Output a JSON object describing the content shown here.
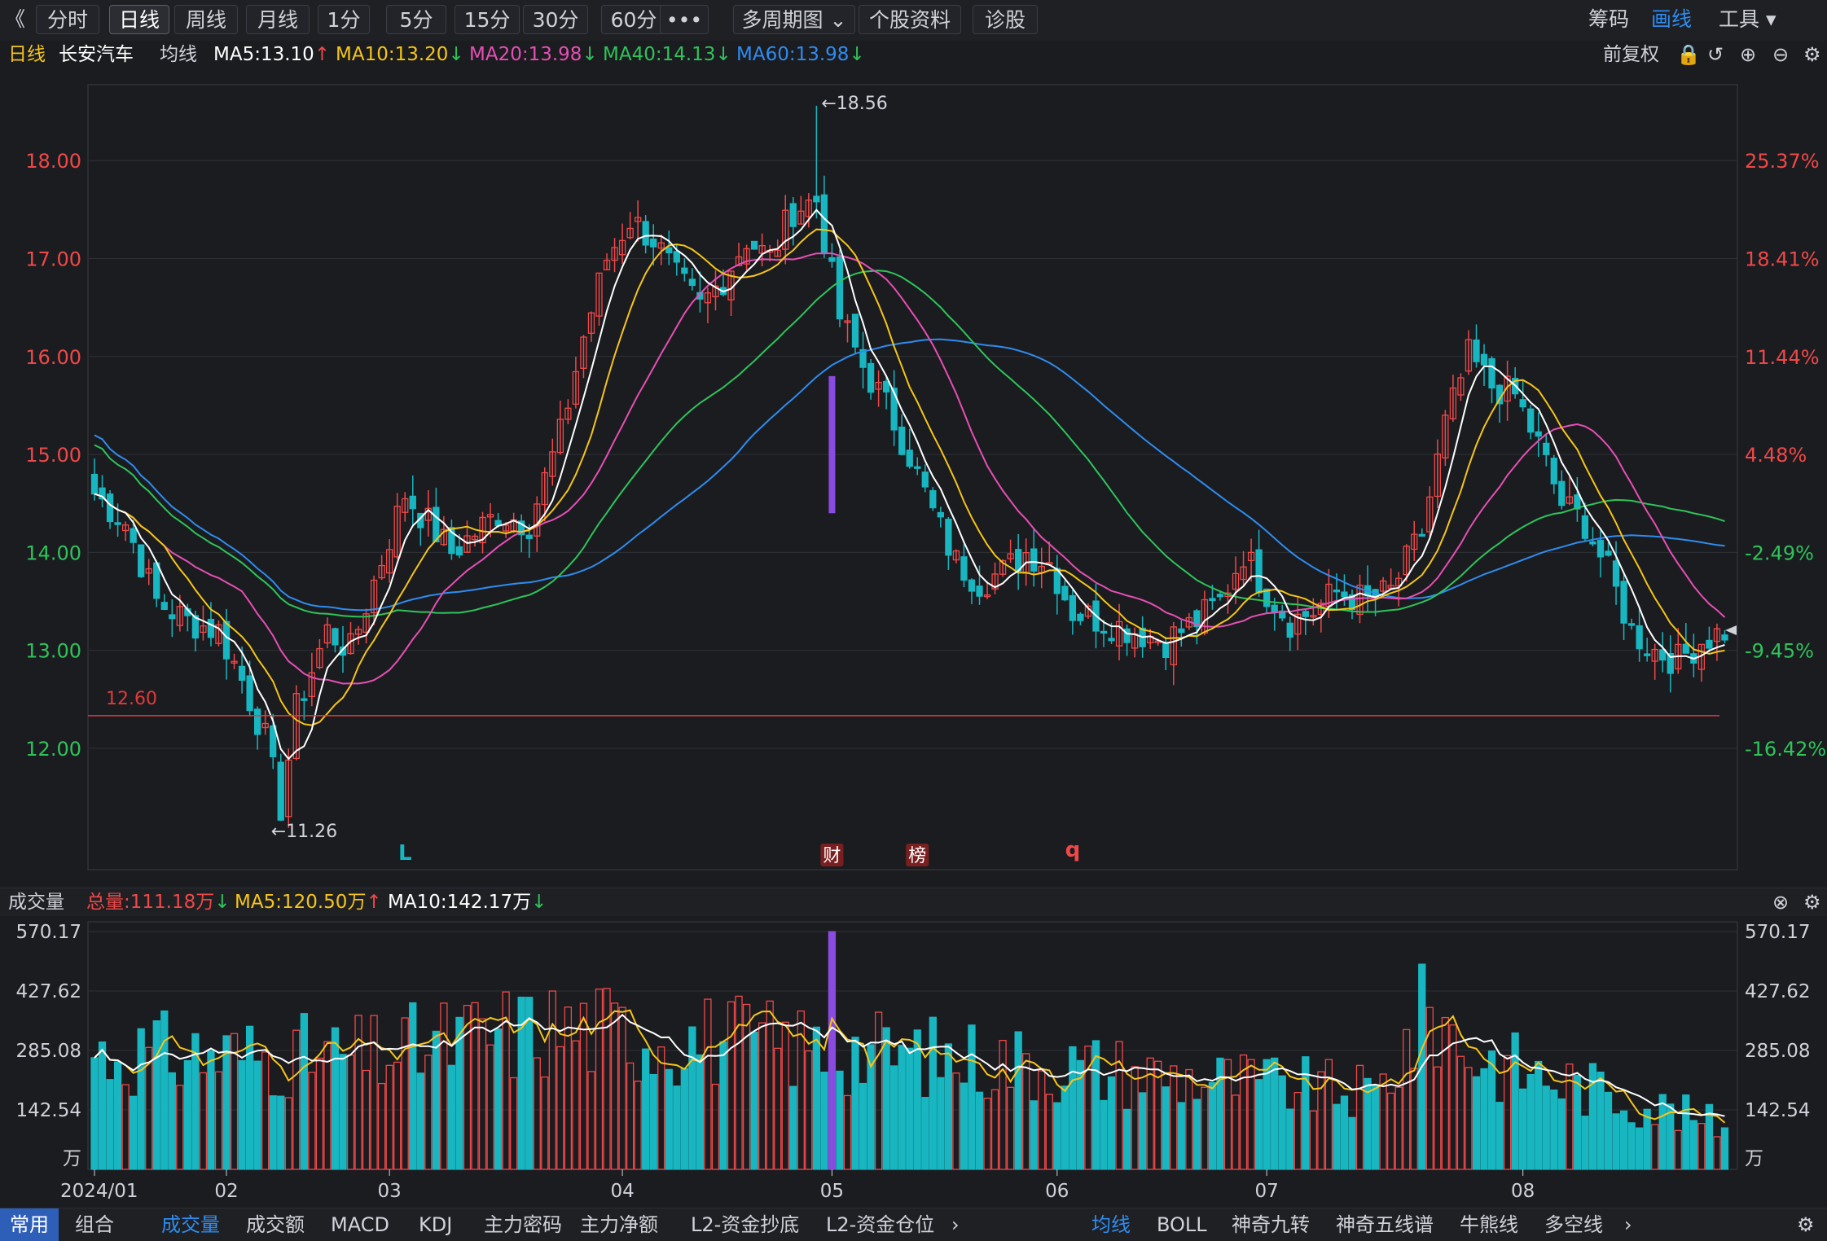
{
  "toolbar": {
    "back_glyph": "《",
    "tabs": [
      "分时",
      "日线",
      "周线",
      "月线",
      "1分",
      "5分",
      "15分",
      "30分",
      "60分",
      "•••",
      "多周期图 ⌄",
      "个股资料",
      "诊股"
    ],
    "active_tab": "日线",
    "right": [
      "筹码",
      "画线",
      "工具 ▾"
    ]
  },
  "info": {
    "period": "日线",
    "stock_name": "长安汽车",
    "ma_label": "均线",
    "ma5": "MA5:13.10",
    "ma10": "MA10:13.20",
    "ma20": "MA20:13.98",
    "ma40": "MA40:14.13",
    "ma60": "MA60:13.98",
    "adjust": "前复权"
  },
  "volume_header": {
    "label": "成交量",
    "total": "总量:111.18万",
    "ma5": "MA5:120.50万",
    "ma10": "MA10:142.17万"
  },
  "bottom": {
    "left_tabs": [
      "常用",
      "组合"
    ],
    "indicators": [
      "成交量",
      "成交额",
      "MACD",
      "KDJ",
      "主力密码",
      "主力净额",
      "L2-资金抄底",
      "L2-资金仓位"
    ],
    "overlays": [
      "均线",
      "BOLL",
      "神奇九转",
      "神奇五线谱",
      "牛熊线",
      "多空线"
    ]
  },
  "colors": {
    "up": "#f04848",
    "down": "#18b6c0",
    "ma5": "#ffffff",
    "ma10": "#f5c518",
    "ma20": "#e64fb4",
    "ma40": "#2ec45a",
    "ma60": "#2e8cf0",
    "highlight": "#8a4be0",
    "support": "#e03a3a"
  },
  "chart_data": {
    "type": "candlestick",
    "title": "长安汽车 日线",
    "price_axis": {
      "ticks": [
        "12.00",
        "13.00",
        "14.00",
        "15.00",
        "16.00",
        "17.00",
        "18.00"
      ],
      "ylim": [
        11.0,
        18.95
      ]
    },
    "pct_axis": {
      "ticks": [
        "-16.42%",
        "-9.45%",
        "-2.49%",
        "4.48%",
        "11.44%",
        "18.41%",
        "25.37%"
      ]
    },
    "x_labels": [
      "2024/01",
      "02",
      "03",
      "04",
      "05",
      "06",
      "07",
      "08"
    ],
    "annotations": {
      "high": "←18.56",
      "low": "←11.26",
      "support": "12.60",
      "support_value": 12.6
    },
    "markers": [
      {
        "text": "L",
        "color": "#18b6c0"
      },
      {
        "text": "财",
        "color": "#f04848"
      },
      {
        "text": "榜",
        "color": "#f04848"
      },
      {
        "text": "q",
        "color": "#f04848"
      }
    ],
    "key_points": [
      [
        0,
        14.6
      ],
      [
        4,
        14.3
      ],
      [
        8,
        13.5
      ],
      [
        12,
        13.3
      ],
      [
        16,
        13.2
      ],
      [
        19,
        12.7
      ],
      [
        22,
        12.1
      ],
      [
        24,
        11.4
      ],
      [
        26,
        12.4
      ],
      [
        30,
        13.2
      ],
      [
        33,
        13.0
      ],
      [
        36,
        13.7
      ],
      [
        40,
        14.6
      ],
      [
        43,
        14.3
      ],
      [
        46,
        14.0
      ],
      [
        49,
        14.2
      ],
      [
        52,
        14.4
      ],
      [
        56,
        14.3
      ],
      [
        60,
        15.2
      ],
      [
        63,
        16.2
      ],
      [
        66,
        17.0
      ],
      [
        69,
        17.4
      ],
      [
        72,
        17.2
      ],
      [
        75,
        16.8
      ],
      [
        78,
        16.5
      ],
      [
        81,
        16.8
      ],
      [
        84,
        17.2
      ],
      [
        87,
        17.0
      ],
      [
        90,
        17.5
      ],
      [
        93,
        17.6
      ],
      [
        96,
        16.4
      ],
      [
        99,
        15.9
      ],
      [
        102,
        15.5
      ],
      [
        105,
        15.0
      ],
      [
        108,
        14.4
      ],
      [
        111,
        13.9
      ],
      [
        114,
        13.7
      ],
      [
        117,
        13.8
      ],
      [
        120,
        14.0
      ],
      [
        123,
        13.9
      ],
      [
        126,
        13.4
      ],
      [
        130,
        13.3
      ],
      [
        134,
        13.2
      ],
      [
        138,
        13.1
      ],
      [
        142,
        13.3
      ],
      [
        145,
        13.5
      ],
      [
        148,
        14.0
      ],
      [
        151,
        13.6
      ],
      [
        154,
        13.3
      ],
      [
        157,
        13.4
      ],
      [
        160,
        13.6
      ],
      [
        164,
        13.5
      ],
      [
        167,
        13.6
      ],
      [
        171,
        14.2
      ],
      [
        174,
        15.3
      ],
      [
        177,
        16.0
      ],
      [
        180,
        15.7
      ],
      [
        183,
        15.6
      ],
      [
        186,
        15.1
      ],
      [
        189,
        14.5
      ],
      [
        192,
        14.3
      ],
      [
        195,
        13.8
      ],
      [
        198,
        13.2
      ],
      [
        201,
        13.0
      ],
      [
        204,
        12.9
      ],
      [
        207,
        13.1
      ],
      [
        210,
        13.2
      ]
    ],
    "volume_axis": {
      "ticks": [
        "142.54",
        "285.08",
        "427.62",
        "570.17"
      ],
      "unit": "万"
    },
    "volume_spikes": [
      [
        0,
        310
      ],
      [
        35,
        300
      ],
      [
        48,
        350
      ],
      [
        60,
        380
      ],
      [
        108,
        300
      ],
      [
        118,
        290
      ],
      [
        165,
        200
      ],
      [
        172,
        430
      ],
      [
        178,
        300
      ],
      [
        210,
        115
      ]
    ],
    "highlight_bar_index": 95
  }
}
